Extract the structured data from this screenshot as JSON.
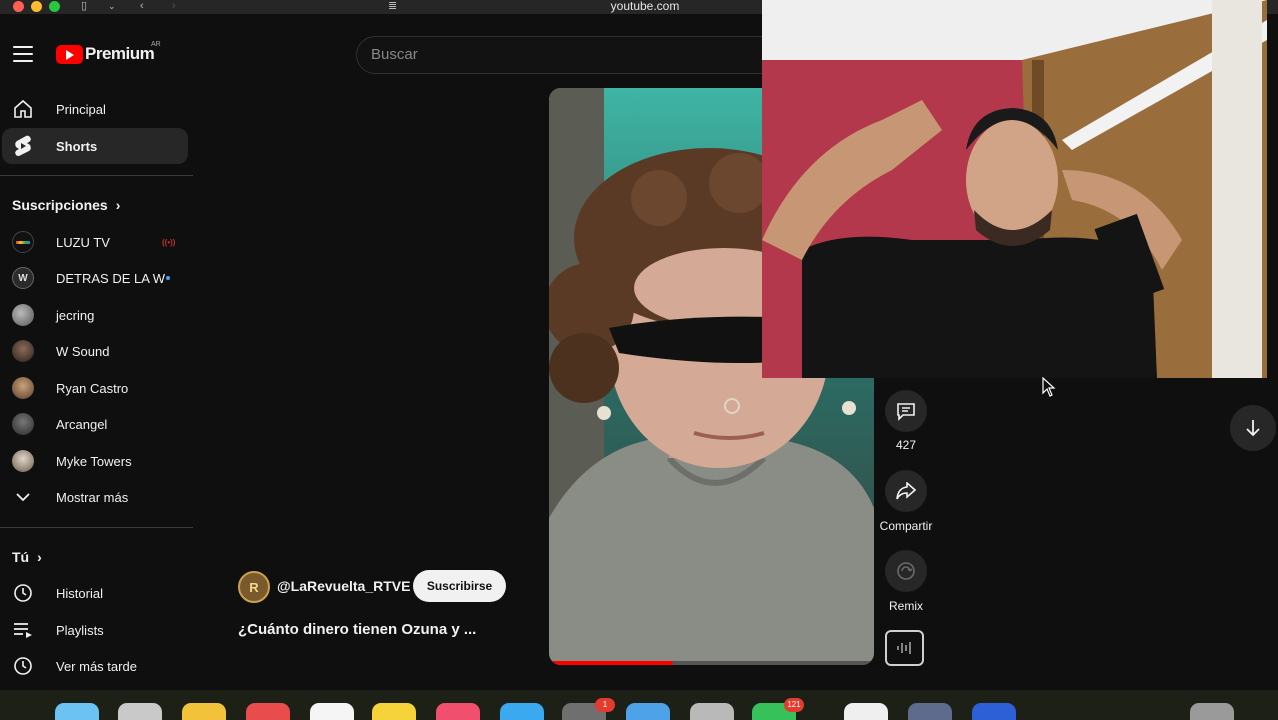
{
  "browser": {
    "url": "youtube.com"
  },
  "header": {
    "logo_text": "Premium",
    "region": "AR",
    "search_placeholder": "Buscar"
  },
  "sidebar": {
    "main": [
      {
        "label": "Principal"
      },
      {
        "label": "Shorts"
      }
    ],
    "subscriptions_title": "Suscripciones",
    "subscriptions": [
      {
        "label": "LUZU TV",
        "badge": "live"
      },
      {
        "label": "DETRAS DE LA W",
        "badge": "new"
      },
      {
        "label": "jecring",
        "badge": ""
      },
      {
        "label": "W Sound",
        "badge": ""
      },
      {
        "label": "Ryan Castro",
        "badge": ""
      },
      {
        "label": "Arcangel",
        "badge": ""
      },
      {
        "label": "Myke Towers",
        "badge": ""
      }
    ],
    "show_more": "Mostrar más",
    "you_title": "Tú",
    "you_items": [
      {
        "label": "Historial"
      },
      {
        "label": "Playlists"
      },
      {
        "label": "Ver más tarde"
      }
    ]
  },
  "short": {
    "channel_handle": "@LaRevuelta_RTVE",
    "channel_initials": "R",
    "subscribe_label": "Suscribirse",
    "title": "¿Cuánto dinero tienen Ozuna y ...",
    "progress": 0.38,
    "actions": {
      "comments_count": "427",
      "share_label": "Compartir",
      "remix_label": "Remix"
    }
  },
  "dock": {
    "badges": [
      "1",
      "121"
    ]
  },
  "colors": {
    "brand_red": "#ff0000",
    "background": "#0f0f0f",
    "chip": "#272727"
  }
}
